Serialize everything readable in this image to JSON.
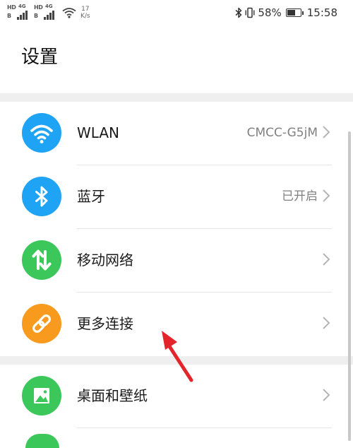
{
  "status_bar": {
    "sim1_hd": "HD",
    "sim1_b": "B",
    "sim1_net": "4G",
    "sim2_hd": "HD",
    "sim2_b": "B",
    "sim2_net": "4G",
    "speed_value": "17",
    "speed_unit": "K/s",
    "battery_percent_text": "58%",
    "battery_level": 0.58,
    "time": "15:58"
  },
  "page": {
    "title": "设置"
  },
  "settings": {
    "items": [
      {
        "label": "WLAN",
        "value": "CMCC-G5jM",
        "icon": "wifi-icon",
        "icon_color": "#1fa3f4"
      },
      {
        "label": "蓝牙",
        "value": "已开启",
        "icon": "bluetooth-icon",
        "icon_color": "#1fa3f4"
      },
      {
        "label": "移动网络",
        "value": "",
        "icon": "mobile-data-icon",
        "icon_color": "#3cc75b"
      },
      {
        "label": "更多连接",
        "value": "",
        "icon": "link-icon",
        "icon_color": "#f79a1e"
      },
      {
        "label": "桌面和壁纸",
        "value": "",
        "icon": "wallpaper-icon",
        "icon_color": "#3cc75b"
      }
    ]
  },
  "colors": {
    "accent_blue": "#1fa3f4",
    "accent_green": "#3cc75b",
    "accent_orange": "#f79a1e",
    "annotation_red": "#e3242b"
  }
}
